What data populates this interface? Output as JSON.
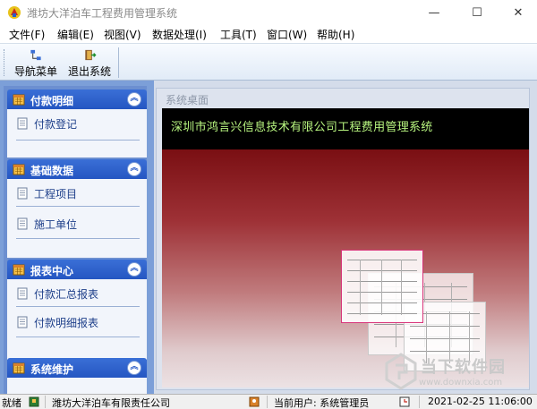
{
  "window": {
    "title": "潍坊大洋泊车工程费用管理系统",
    "minimize_glyph": "—",
    "maximize_glyph": "☐",
    "close_glyph": "✕"
  },
  "menu": {
    "items": [
      "文件(F)",
      "编辑(E)",
      "视图(V)",
      "数据处理(I)",
      "工具(T)",
      "窗口(W)",
      "帮助(H)"
    ]
  },
  "toolbar": {
    "nav_label": "导航菜单",
    "exit_label": "退出系统"
  },
  "sidebar": {
    "groups": [
      {
        "title": "付款明细",
        "items": [
          "付款登记"
        ]
      },
      {
        "title": "基础数据",
        "items": [
          "工程项目",
          "施工单位"
        ]
      },
      {
        "title": "报表中心",
        "items": [
          "付款汇总报表",
          "付款明细报表"
        ]
      },
      {
        "title": "系统维护",
        "items": []
      }
    ],
    "collapse_glyph": "︽"
  },
  "desktop": {
    "panel_title": "系统桌面",
    "banner": "深圳市鸿言兴信息技术有限公司工程费用管理系统"
  },
  "watermark": {
    "text": "当下软件园",
    "url": "www.downxia.com"
  },
  "status": {
    "ready": "就绪",
    "company": "潍坊大洋泊车有限责任公司",
    "user": "当前用户: 系统管理员",
    "datetime": "2021-02-25 11:06:00"
  },
  "colors": {
    "sidebar_header": "#2b5cc6",
    "banner_text": "#b7f47f",
    "desktop_gradient_top": "#7a0f13"
  }
}
